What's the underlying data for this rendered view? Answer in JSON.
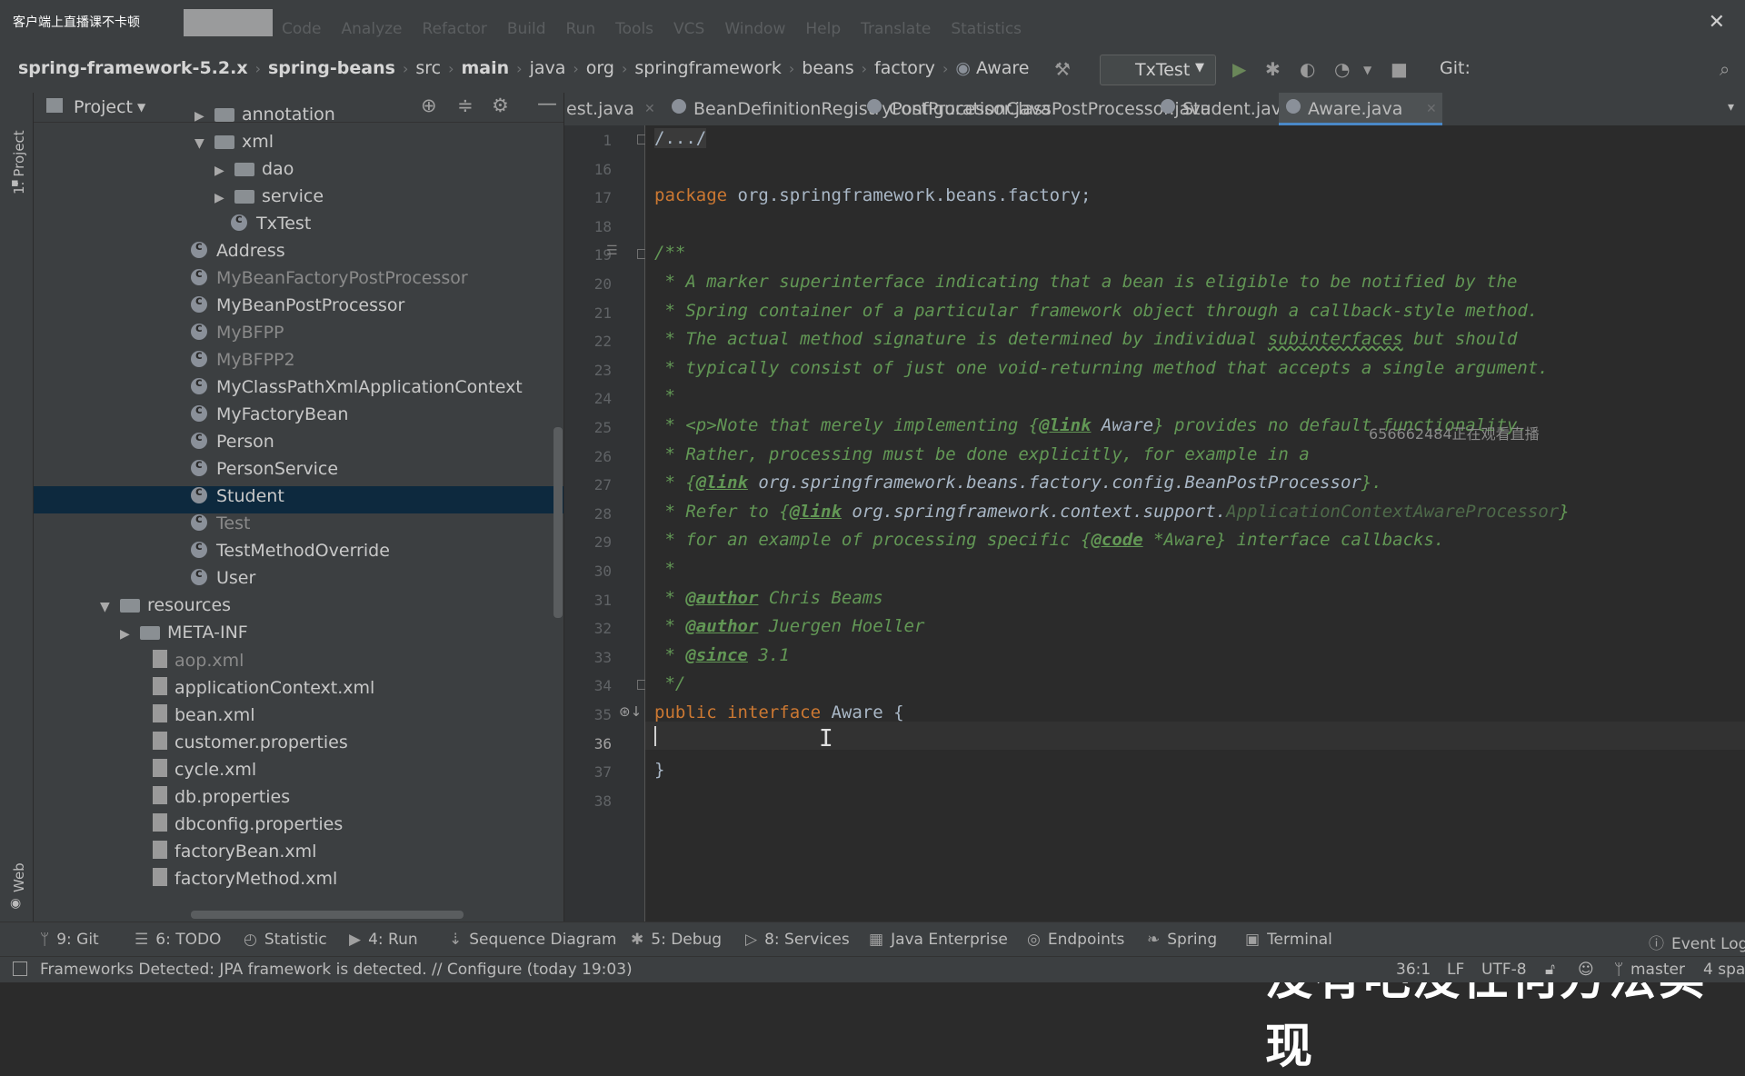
{
  "overlay": {
    "badge": "客户端上直播课不卡顿",
    "watermark": "656662484正在观看直播",
    "subtitle": "没有吧没任何方法实现"
  },
  "menu": {
    "items": [
      "Code",
      "Analyze",
      "Refactor",
      "Build",
      "Run",
      "Tools",
      "VCS",
      "Window",
      "Help",
      "Translate",
      "Statistics"
    ]
  },
  "breadcrumbs": [
    "spring-framework-5.2.x",
    "spring-beans",
    "src",
    "main",
    "java",
    "org",
    "springframework",
    "beans",
    "factory",
    "Aware"
  ],
  "navtools": {
    "run_config": "TxTest",
    "git_label": "Git:"
  },
  "leftstrip": {
    "project": "1: Project",
    "web": "Web"
  },
  "project": {
    "title": "Project",
    "tree": [
      {
        "label": "annotation",
        "kind": "folder",
        "indent": 1,
        "arrow": "▶"
      },
      {
        "label": "xml",
        "kind": "folder",
        "indent": 1,
        "arrow": "▼"
      },
      {
        "label": "dao",
        "kind": "folder",
        "indent": 2,
        "arrow": "▶"
      },
      {
        "label": "service",
        "kind": "folder",
        "indent": 2,
        "arrow": "▶"
      },
      {
        "label": "TxTest",
        "kind": "class",
        "indent": 3,
        "arrow": ""
      },
      {
        "label": "Address",
        "kind": "class",
        "indent": 0,
        "arrow": ""
      },
      {
        "label": "MyBeanFactoryPostProcessor",
        "kind": "class",
        "indent": 0,
        "arrow": "",
        "dim": true
      },
      {
        "label": "MyBeanPostProcessor",
        "kind": "class",
        "indent": 0,
        "arrow": ""
      },
      {
        "label": "MyBFPP",
        "kind": "class",
        "indent": 0,
        "arrow": "",
        "dim": true
      },
      {
        "label": "MyBFPP2",
        "kind": "class",
        "indent": 0,
        "arrow": "",
        "dim": true
      },
      {
        "label": "MyClassPathXmlApplicationContext",
        "kind": "class",
        "indent": 0,
        "arrow": ""
      },
      {
        "label": "MyFactoryBean",
        "kind": "class",
        "indent": 0,
        "arrow": ""
      },
      {
        "label": "Person",
        "kind": "class",
        "indent": 0,
        "arrow": ""
      },
      {
        "label": "PersonService",
        "kind": "class",
        "indent": 0,
        "arrow": ""
      },
      {
        "label": "Student",
        "kind": "class",
        "indent": 0,
        "arrow": "",
        "selected": true
      },
      {
        "label": "Test",
        "kind": "class",
        "indent": 0,
        "arrow": "",
        "dim": true
      },
      {
        "label": "TestMethodOverride",
        "kind": "class",
        "indent": 0,
        "arrow": ""
      },
      {
        "label": "User",
        "kind": "class",
        "indent": 0,
        "arrow": ""
      },
      {
        "label": "resources",
        "kind": "folder",
        "indent": -2,
        "arrow": "▼"
      },
      {
        "label": "META-INF",
        "kind": "folder",
        "indent": -1,
        "arrow": "▶"
      },
      {
        "label": "aop.xml",
        "kind": "file",
        "indent": -1,
        "arrow": "",
        "dim": true
      },
      {
        "label": "applicationContext.xml",
        "kind": "file",
        "indent": -1,
        "arrow": ""
      },
      {
        "label": "bean.xml",
        "kind": "file",
        "indent": -1,
        "arrow": ""
      },
      {
        "label": "customer.properties",
        "kind": "file",
        "indent": -1,
        "arrow": ""
      },
      {
        "label": "cycle.xml",
        "kind": "file",
        "indent": -1,
        "arrow": ""
      },
      {
        "label": "db.properties",
        "kind": "file",
        "indent": -1,
        "arrow": ""
      },
      {
        "label": "dbconfig.properties",
        "kind": "file",
        "indent": -1,
        "arrow": ""
      },
      {
        "label": "factoryBean.xml",
        "kind": "file",
        "indent": -1,
        "arrow": ""
      },
      {
        "label": "factoryMethod.xml",
        "kind": "file",
        "indent": -1,
        "arrow": ""
      }
    ]
  },
  "tabs": [
    {
      "label": "est.java",
      "active": false
    },
    {
      "label": "BeanDefinitionRegistryPostProcessor.java",
      "active": false
    },
    {
      "label": "ConfigurationClassPostProcessor.java",
      "active": false
    },
    {
      "label": "Student.java",
      "active": false
    },
    {
      "label": "Aware.java",
      "active": true
    }
  ],
  "editor": {
    "line_numbers": [
      "1",
      "16",
      "17",
      "18",
      "19",
      "20",
      "21",
      "22",
      "23",
      "24",
      "25",
      "26",
      "27",
      "28",
      "29",
      "30",
      "31",
      "32",
      "33",
      "34",
      "35",
      "36",
      "37",
      "38"
    ],
    "current_line": "36",
    "lines": [
      [
        {
          "t": "/.../",
          "c": "fold"
        }
      ],
      [],
      [
        {
          "t": "package ",
          "c": "kw"
        },
        {
          "t": "org.springframework.beans.factory;",
          "c": "plain"
        }
      ],
      [],
      [
        {
          "t": "/**",
          "c": "doc"
        }
      ],
      [
        {
          "t": " * A marker superinterface indicating that a bean is eligible to be notified by the",
          "c": "doc"
        }
      ],
      [
        {
          "t": " * Spring container of a particular framework object through a callback-style method.",
          "c": "doc"
        }
      ],
      [
        {
          "t": " * The actual method signature is determined by individual ",
          "c": "doc"
        },
        {
          "t": "subinterfaces",
          "c": "docu"
        },
        {
          "t": " but should",
          "c": "doc"
        }
      ],
      [
        {
          "t": " * typically consist of just one void-returning method that accepts a single argument.",
          "c": "doc"
        }
      ],
      [
        {
          "t": " *",
          "c": "doc"
        }
      ],
      [
        {
          "t": " * <p>Note that merely implementing {",
          "c": "doc"
        },
        {
          "t": "@link",
          "c": "tag"
        },
        {
          "t": " Aware",
          "c": "docref"
        },
        {
          "t": "} provides no default functionality.",
          "c": "doc"
        }
      ],
      [
        {
          "t": " * Rather, processing must be done explicitly, for example in a",
          "c": "doc"
        }
      ],
      [
        {
          "t": " * {",
          "c": "doc"
        },
        {
          "t": "@link",
          "c": "tag"
        },
        {
          "t": " org.springframework.beans.factory.config.BeanPostProcessor",
          "c": "docref"
        },
        {
          "t": "}.",
          "c": "doc"
        }
      ],
      [
        {
          "t": " * Refer to {",
          "c": "doc"
        },
        {
          "t": "@link",
          "c": "tag"
        },
        {
          "t": " org.springframework.context.support.",
          "c": "docref"
        },
        {
          "t": "ApplicationContextAwareProcessor",
          "c": "docdim"
        },
        {
          "t": "}",
          "c": "doc"
        }
      ],
      [
        {
          "t": " * for an example of processing specific {",
          "c": "doc"
        },
        {
          "t": "@code",
          "c": "tag"
        },
        {
          "t": " *Aware} interface callbacks.",
          "c": "doc"
        }
      ],
      [
        {
          "t": " *",
          "c": "doc"
        }
      ],
      [
        {
          "t": " * ",
          "c": "doc"
        },
        {
          "t": "@author",
          "c": "tag"
        },
        {
          "t": " Chris Beams",
          "c": "doc"
        }
      ],
      [
        {
          "t": " * ",
          "c": "doc"
        },
        {
          "t": "@author",
          "c": "tag"
        },
        {
          "t": " Juergen Hoeller",
          "c": "doc"
        }
      ],
      [
        {
          "t": " * ",
          "c": "doc"
        },
        {
          "t": "@since",
          "c": "tag"
        },
        {
          "t": " 3.1",
          "c": "doc"
        }
      ],
      [
        {
          "t": " */",
          "c": "doc"
        }
      ],
      [
        {
          "t": "public interface ",
          "c": "kw"
        },
        {
          "t": "Aware {",
          "c": "plain"
        }
      ],
      [],
      [
        {
          "t": "}",
          "c": "plain"
        }
      ],
      []
    ]
  },
  "toolwindows": [
    "9: Git",
    "6: TODO",
    "Statistic",
    "4: Run",
    "Sequence Diagram",
    "5: Debug",
    "8: Services",
    "Java Enterprise",
    "Endpoints",
    "Spring",
    "Terminal",
    "Event Log"
  ],
  "status": {
    "message": "Frameworks Detected: JPA framework is detected. // Configure (today 19:03)",
    "position": "36:1",
    "line_sep": "LF",
    "encoding": "UTF-8",
    "branch": "master",
    "indent": "4 spa"
  }
}
